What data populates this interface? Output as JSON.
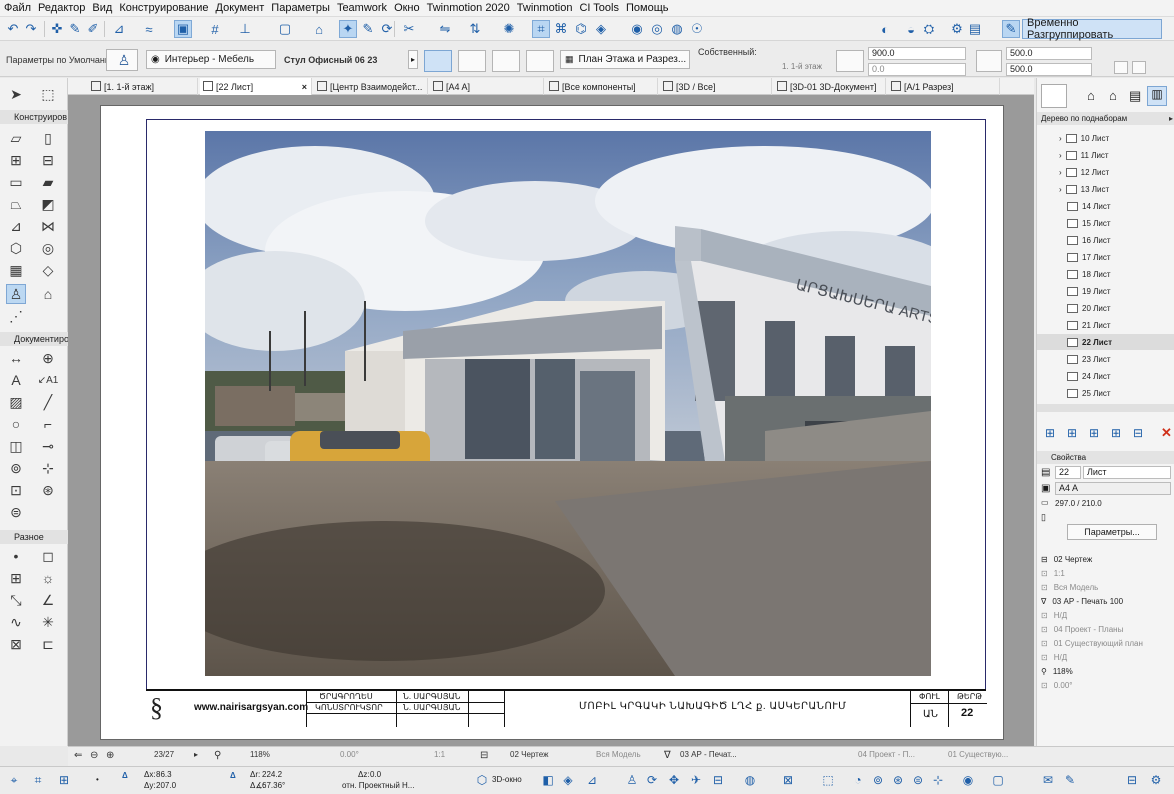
{
  "menu": [
    "Файл",
    "Редактор",
    "Вид",
    "Конструирование",
    "Документ",
    "Параметры",
    "Teamwork",
    "Окно",
    "Twinmotion 2020",
    "Twinmotion",
    "CI Tools",
    "Помощь"
  ],
  "toolbar": {
    "temp_unlock_label": "Временно Разгруппировать"
  },
  "infobox": {
    "defaults_label": "Параметры по Умолчанию",
    "layer": "Интерьер - Мебель",
    "object_name": "Стул Офисный 06 23",
    "view_type": "План Этажа и Разрез...",
    "own_label": "Собственный:",
    "story": "1. 1-й этаж",
    "field1": "900.0",
    "field2": "0.0",
    "field3": "500.0",
    "field4": "500.0"
  },
  "tabs": [
    {
      "label": "[1. 1-й этаж]"
    },
    {
      "label": "[22 Лист]"
    },
    {
      "label": "[Центр Взаимодейст..."
    },
    {
      "label": "[A4 A]"
    },
    {
      "label": "[Все компоненты]"
    },
    {
      "label": "[3D / Все]"
    },
    {
      "label": "[3D-01 3D-Документ]"
    },
    {
      "label": "[A/1 Разрез]"
    }
  ],
  "toolbox": {
    "sections": [
      "Конструиров",
      "Документиро",
      "Разное"
    ]
  },
  "titleblock": {
    "website": "www.nairisargsyan.com",
    "role1": "ԾՐԱԳՐՈՂԵՍ",
    "role2": "ԿՈՆՍՏՐՈՒԿՏՈՐ",
    "name1": "Ն. ՍԱՐԳՍՅԱՆ",
    "name2": "Ն. ՍԱՐԳՍՅԱՆ",
    "project_title": "ՄՈԲԻԼ ԿՐԳԱԿԻ ՆԱԽԱԳԻԾ ԼՂՀ ք. ԱՍԿԵՐԱՆՈՒՄ",
    "stage_header": "ՓՈՒԼ",
    "sheet_header": "ԹԵՐԹ",
    "stage_value": "ԱՆ",
    "sheet_value": "22"
  },
  "navigator": {
    "dropdown": "Дерево по поднаборам",
    "items": [
      "10 Лист",
      "11 Лист",
      "12 Лист",
      "13 Лист",
      "14 Лист",
      "15 Лист",
      "16 Лист",
      "17 Лист",
      "18 Лист",
      "19 Лист",
      "20 Лист",
      "21 Лист",
      "22 Лист",
      "23 Лист",
      "24 Лист",
      "25 Лист"
    ],
    "selected": "22 Лист",
    "properties_header": "Свойства",
    "prop_number": "22",
    "prop_name": "Лист",
    "prop_layout": "A4 A",
    "prop_size": "297.0 / 210.0",
    "params_button": "Параметры...",
    "view_props": [
      {
        "label": "02 Чертеж",
        "dim": false
      },
      {
        "label": "1:1",
        "dim": true
      },
      {
        "label": "Вся Модель",
        "dim": true
      },
      {
        "label": "03 АР - Печать 100",
        "dim": false
      },
      {
        "label": "Н/Д",
        "dim": true
      },
      {
        "label": "04 Проект - Планы",
        "dim": true
      },
      {
        "label": "01 Существующий план",
        "dim": true
      },
      {
        "label": "Н/Д",
        "dim": true
      },
      {
        "label": "118%",
        "dim": false
      },
      {
        "label": "0.00°",
        "dim": true
      }
    ]
  },
  "statusbar": {
    "page": "23/27",
    "zoom": "118%",
    "angle": "0.00°",
    "scale": "1:1",
    "layer_combo": "02 Чертеж",
    "model": "Вся Модель",
    "pen_set": "03 АР - Печат...",
    "mvo": "04 Проект - П...",
    "renovation": "01 Существую..."
  },
  "coords": {
    "dx": "86.3",
    "dy": "207.0",
    "dr": "224.2",
    "da": "67.36°",
    "dz": "0.0",
    "ref": "отн. Проектный Н..."
  },
  "bottom": {
    "view3d": "3D-окно"
  }
}
